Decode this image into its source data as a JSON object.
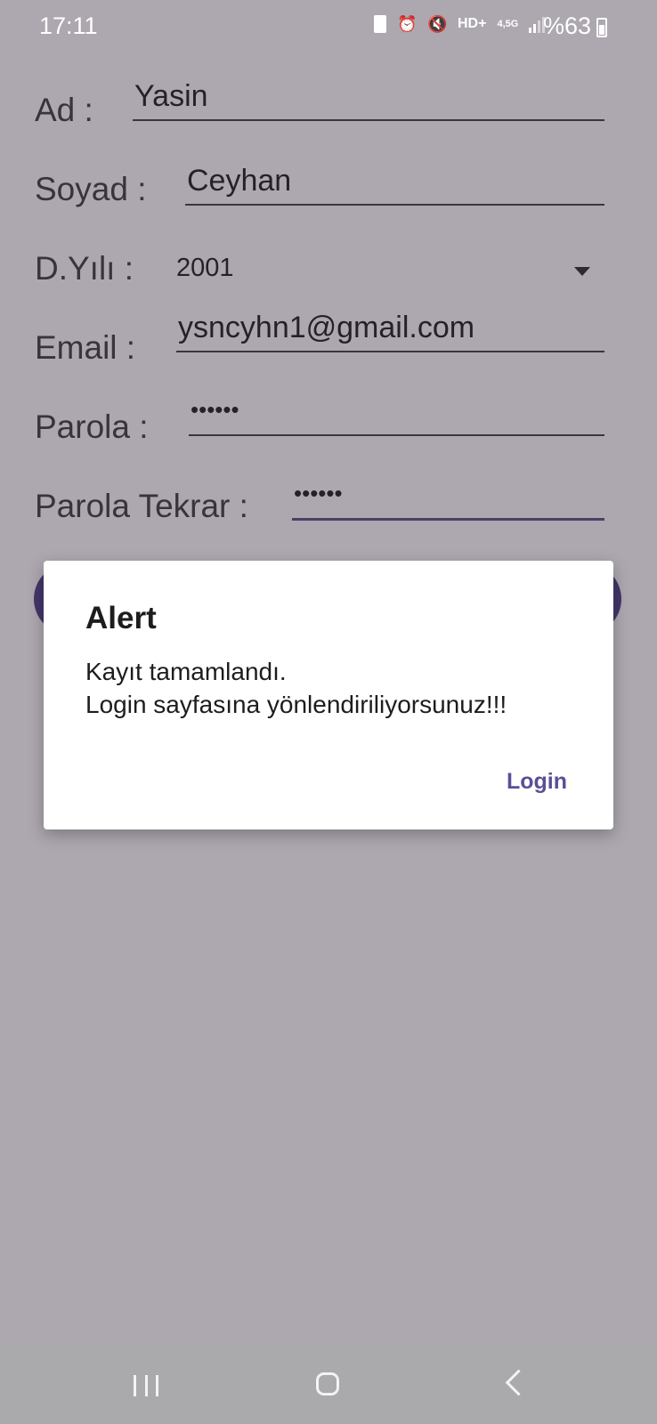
{
  "status_bar": {
    "time": "17:11",
    "network": "4,5G",
    "battery": "%63",
    "icons": [
      "sim-card-icon",
      "alarm-icon",
      "mute-icon",
      "hd-voice-icon",
      "network-icon",
      "signal-icon",
      "battery-icon"
    ]
  },
  "form": {
    "name_label": "Ad :",
    "name_value": "Yasin",
    "surname_label": "Soyad :",
    "surname_value": "Ceyhan",
    "birth_year_label": "D.Yılı :",
    "birth_year_value": "2001",
    "email_label": "Email :",
    "email_value": "ysncyhn1@gmail.com",
    "password_label": "Parola :",
    "password_value": "••••••",
    "password_repeat_label": "Parola Tekrar :",
    "password_repeat_value": "••••••"
  },
  "dialog": {
    "title": "Alert",
    "message_line1": "Kayıt tamamlandı.",
    "message_line2": "Login sayfasına yönlendiriliyorsunuz!!!",
    "action_label": "Login"
  },
  "colors": {
    "accent": "#5b4f95",
    "button": "#4f3f8a",
    "scrim": "#aeaaaf",
    "nav_bar": "#aaa9ab"
  }
}
